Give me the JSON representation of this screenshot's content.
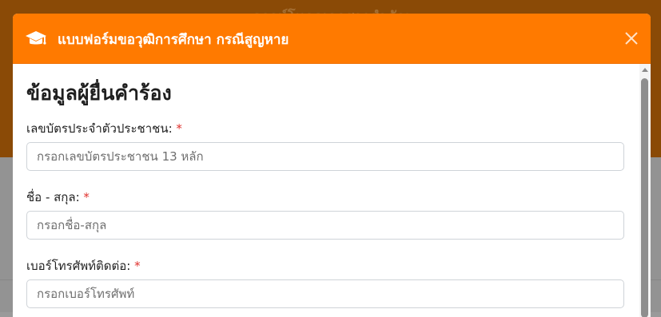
{
  "background": {
    "header_text": "ดาวน์โหลดเอกสารสำคัญ"
  },
  "modal": {
    "title": "แบบฟอร์มขอวุฒิการศึกษา กรณีสูญหาย",
    "header_icon": "graduation-cap-icon",
    "close_icon": "close-icon",
    "accent_color": "#ff7a00"
  },
  "form": {
    "section_title": "ข้อมูลผู้ยื่นคำร้อง",
    "required_mark": "*",
    "fields": [
      {
        "label": "เลขบัตรประจำตัวประชาชน:",
        "placeholder": "กรอกเลขบัตรประชาชน 13 หลัก",
        "value": ""
      },
      {
        "label": "ชื่อ - สกุล:",
        "placeholder": "กรอกชื่อ-สกุล",
        "value": ""
      },
      {
        "label": "เบอร์โทรศัพท์ติดต่อ:",
        "placeholder": "กรอกเบอร์โทรศัพท์",
        "value": ""
      }
    ]
  }
}
